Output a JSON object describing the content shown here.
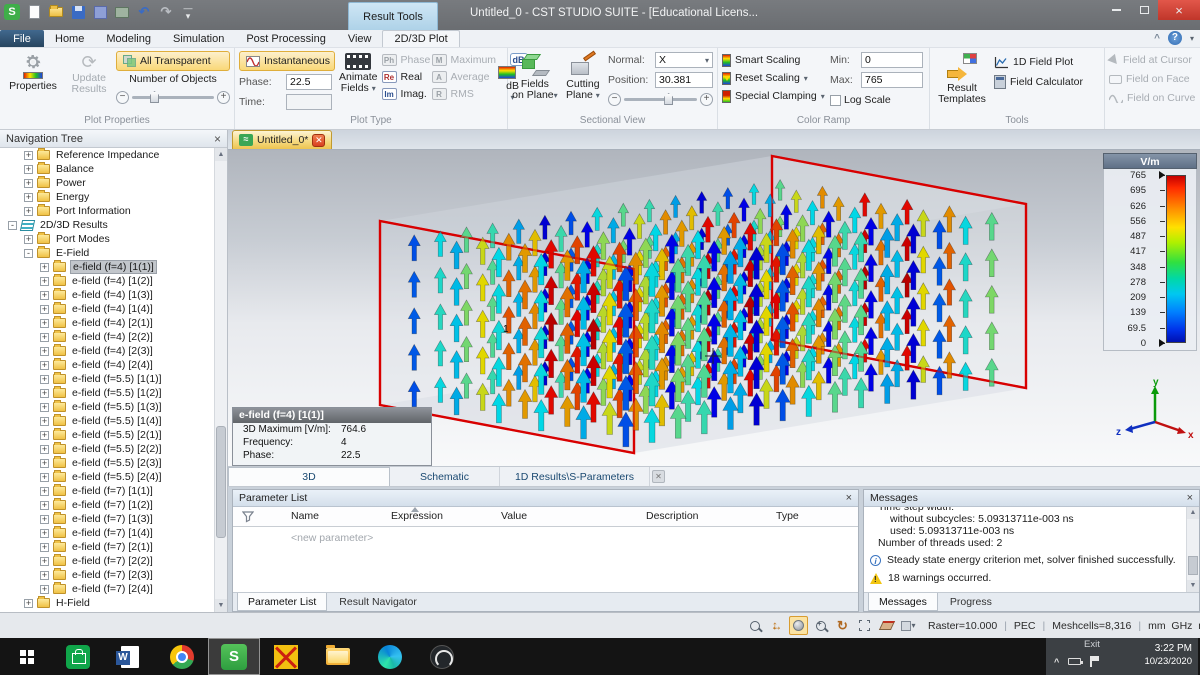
{
  "titlebar": {
    "context_tab": "Result Tools",
    "title": "Untitled_0 - CST STUDIO SUITE - [Educational Licens..."
  },
  "menubar": {
    "file": "File",
    "tabs": [
      "Home",
      "Modeling",
      "Simulation",
      "Post Processing",
      "View",
      "2D/3D Plot"
    ],
    "active_tab": "2D/3D Plot"
  },
  "ribbon": {
    "properties_label": "Properties",
    "update_results_label": "Update Results",
    "all_transparent": "All Transparent",
    "number_of_objects": "Number of Objects",
    "group_plot_properties": "Plot Properties",
    "instantaneous": "Instantaneous",
    "phase_label": "Phase:",
    "phase_value": "22.5",
    "time_label": "Time:",
    "time_value": "",
    "animate_fields_1": "Animate",
    "animate_fields_2": "Fields",
    "type_phase": "Phase",
    "type_real": "Real",
    "type_imag": "Imag.",
    "type_maximum": "Maximum",
    "type_average": "Average",
    "type_rms": "RMS",
    "db_label": "dB",
    "group_plot_type": "Plot Type",
    "fields_on_plane_1": "Fields",
    "fields_on_plane_2": "on Plane",
    "cutting_plane_1": "Cutting",
    "cutting_plane_2": "Plane",
    "normal_label": "Normal:",
    "normal_value": "X",
    "position_label": "Position:",
    "position_value": "30.381",
    "group_sectional_view": "Sectional View",
    "smart_scaling": "Smart Scaling",
    "reset_scaling": "Reset Scaling",
    "special_clamping": "Special Clamping",
    "min_label": "Min:",
    "min_value": "0",
    "max_label": "Max:",
    "max_value": "765",
    "log_scale": "Log Scale",
    "group_color_ramp": "Color Ramp",
    "result_templates_1": "Result",
    "result_templates_2": "Templates",
    "field_plot_1d": "1D Field Plot",
    "field_calculator": "Field Calculator",
    "field_at_cursor": "Field at Cursor",
    "field_on_face": "Field on Face",
    "field_on_curve": "Field on Curve",
    "group_tools": "Tools"
  },
  "navigation_tree": {
    "title": "Navigation Tree",
    "items": [
      {
        "level": 2,
        "exp": "+",
        "icon": "folder",
        "label": "Reference Impedance"
      },
      {
        "level": 2,
        "exp": "+",
        "icon": "folder",
        "label": "Balance"
      },
      {
        "level": 2,
        "exp": "+",
        "icon": "folder",
        "label": "Power"
      },
      {
        "level": 2,
        "exp": "+",
        "icon": "folder",
        "label": "Energy"
      },
      {
        "level": 2,
        "exp": "+",
        "icon": "folder",
        "label": "Port Information"
      },
      {
        "level": 1,
        "exp": "-",
        "icon": "results",
        "label": "2D/3D Results"
      },
      {
        "level": 2,
        "exp": "+",
        "icon": "folder",
        "label": "Port Modes"
      },
      {
        "level": 2,
        "exp": "-",
        "icon": "folder",
        "label": "E-Field"
      },
      {
        "level": 3,
        "exp": "+",
        "icon": "folder",
        "label": "e-field (f=4) [1(1)]",
        "selected": true
      },
      {
        "level": 3,
        "exp": "+",
        "icon": "folder",
        "label": "e-field (f=4) [1(2)]"
      },
      {
        "level": 3,
        "exp": "+",
        "icon": "folder",
        "label": "e-field (f=4) [1(3)]"
      },
      {
        "level": 3,
        "exp": "+",
        "icon": "folder",
        "label": "e-field (f=4) [1(4)]"
      },
      {
        "level": 3,
        "exp": "+",
        "icon": "folder",
        "label": "e-field (f=4) [2(1)]"
      },
      {
        "level": 3,
        "exp": "+",
        "icon": "folder",
        "label": "e-field (f=4) [2(2)]"
      },
      {
        "level": 3,
        "exp": "+",
        "icon": "folder",
        "label": "e-field (f=4) [2(3)]"
      },
      {
        "level": 3,
        "exp": "+",
        "icon": "folder",
        "label": "e-field (f=4) [2(4)]"
      },
      {
        "level": 3,
        "exp": "+",
        "icon": "folder",
        "label": "e-field (f=5.5) [1(1)]"
      },
      {
        "level": 3,
        "exp": "+",
        "icon": "folder",
        "label": "e-field (f=5.5) [1(2)]"
      },
      {
        "level": 3,
        "exp": "+",
        "icon": "folder",
        "label": "e-field (f=5.5) [1(3)]"
      },
      {
        "level": 3,
        "exp": "+",
        "icon": "folder",
        "label": "e-field (f=5.5) [1(4)]"
      },
      {
        "level": 3,
        "exp": "+",
        "icon": "folder",
        "label": "e-field (f=5.5) [2(1)]"
      },
      {
        "level": 3,
        "exp": "+",
        "icon": "folder",
        "label": "e-field (f=5.5) [2(2)]"
      },
      {
        "level": 3,
        "exp": "+",
        "icon": "folder",
        "label": "e-field (f=5.5) [2(3)]"
      },
      {
        "level": 3,
        "exp": "+",
        "icon": "folder",
        "label": "e-field (f=5.5) [2(4)]"
      },
      {
        "level": 3,
        "exp": "+",
        "icon": "folder",
        "label": "e-field (f=7) [1(1)]"
      },
      {
        "level": 3,
        "exp": "+",
        "icon": "folder",
        "label": "e-field (f=7) [1(2)]"
      },
      {
        "level": 3,
        "exp": "+",
        "icon": "folder",
        "label": "e-field (f=7) [1(3)]"
      },
      {
        "level": 3,
        "exp": "+",
        "icon": "folder",
        "label": "e-field (f=7) [1(4)]"
      },
      {
        "level": 3,
        "exp": "+",
        "icon": "folder",
        "label": "e-field (f=7) [2(1)]"
      },
      {
        "level": 3,
        "exp": "+",
        "icon": "folder",
        "label": "e-field (f=7) [2(2)]"
      },
      {
        "level": 3,
        "exp": "+",
        "icon": "folder",
        "label": "e-field (f=7) [2(3)]"
      },
      {
        "level": 3,
        "exp": "+",
        "icon": "folder",
        "label": "e-field (f=7) [2(4)]"
      },
      {
        "level": 2,
        "exp": "+",
        "icon": "folder",
        "label": "H-Field"
      }
    ]
  },
  "document": {
    "tab_title": "Untitled_0*",
    "view_tabs": [
      "3D",
      "Schematic",
      "1D Results\\S-Parameters"
    ],
    "active_view_tab": "3D"
  },
  "plot": {
    "color_scale": {
      "unit": "V/m",
      "ticks": [
        "765",
        "695",
        "626",
        "556",
        "487",
        "417",
        "348",
        "278",
        "209",
        "139",
        "69.5",
        "0"
      ]
    },
    "info_box": {
      "title": "e-field (f=4) [1(1)]",
      "rows": [
        {
          "label": "3D Maximum [V/m]:",
          "value": "764.6"
        },
        {
          "label": "Frequency:",
          "value": "4"
        },
        {
          "label": "Phase:",
          "value": "22.5"
        }
      ]
    },
    "axes": {
      "x": "x",
      "y": "y",
      "z": "z"
    },
    "port_label": "1"
  },
  "field_plot": {
    "nx": 15,
    "nz": 6,
    "ny": 5,
    "k": 2.5,
    "phi": 0.15
  },
  "parameter_list": {
    "title": "Parameter List",
    "columns": [
      "Name",
      "Expression",
      "Value",
      "Description",
      "Type"
    ],
    "new_row": "<new parameter>",
    "tabs": [
      "Parameter List",
      "Result Navigator"
    ],
    "active_tab": "Parameter List"
  },
  "messages": {
    "title": "Messages",
    "lines": [
      {
        "text": "Time step width:",
        "indent": 1,
        "clip": true
      },
      {
        "text": "without subcycles: 5.09313711e-003 ns",
        "indent": 2
      },
      {
        "text": "used: 5.09313711e-003 ns",
        "indent": 2
      },
      {
        "text": "Number of threads used: 2",
        "indent": 1
      }
    ],
    "info_line": "Steady state energy criterion met, solver finished successfully.",
    "warning_line": "18 warnings occurred.",
    "tabs": [
      "Messages",
      "Progress"
    ],
    "active_tab": "Messages"
  },
  "status_bar": {
    "items": [
      "Raster=10.000",
      "PEC",
      "Meshcells=8,316",
      "mm  GHz  ns  K"
    ]
  },
  "taskbar": {
    "apps": [
      "windows",
      "store",
      "word",
      "chrome",
      "cst",
      "cst-legacy",
      "explorer",
      "edge",
      "obs"
    ],
    "active_app": "cst",
    "exit": "Exit",
    "time": "3:22 PM",
    "date": "10/23/2020"
  }
}
